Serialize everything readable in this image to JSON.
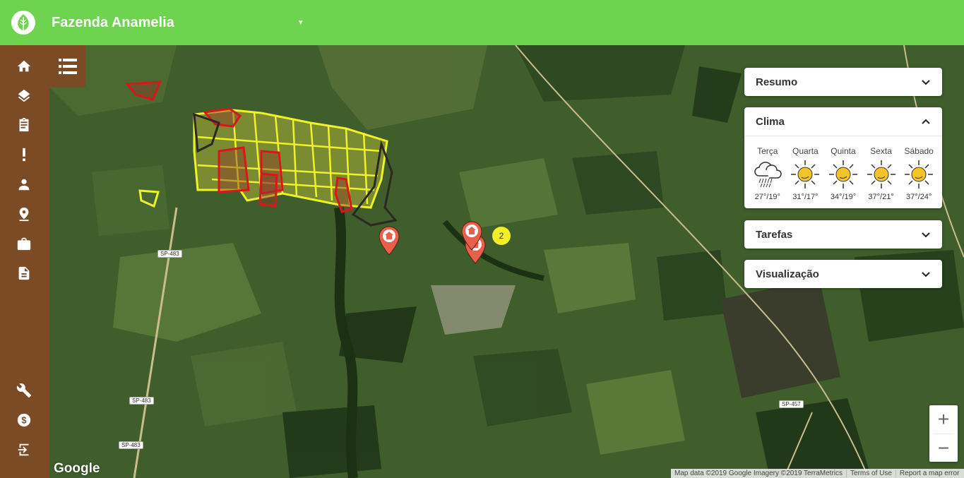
{
  "app": {
    "farm_name": "Fazenda Anamelia",
    "dropdown_caret": "▾",
    "colors": {
      "topbar": "#6ed34e",
      "sidebar": "#7a4b25",
      "field_yellow": "#f1f12a",
      "field_red": "#d81818",
      "marker": "#e8604c",
      "cluster": "#f2ef27"
    }
  },
  "sidebar": {
    "items": [
      {
        "name": "home-icon"
      },
      {
        "name": "layers-icon"
      },
      {
        "name": "clipboard-icon"
      },
      {
        "name": "alert-icon"
      },
      {
        "name": "person-icon"
      },
      {
        "name": "map-pin-icon"
      },
      {
        "name": "briefcase-icon"
      },
      {
        "name": "document-icon"
      },
      {
        "name": "wrench-icon"
      },
      {
        "name": "dollar-icon"
      },
      {
        "name": "logout-icon"
      }
    ]
  },
  "panels": {
    "resumo": {
      "title": "Resumo"
    },
    "clima": {
      "title": "Clima",
      "days": [
        {
          "name": "Terça",
          "temp": "27°/19°",
          "icon": "rain-cloud-icon"
        },
        {
          "name": "Quarta",
          "temp": "31°/17°",
          "icon": "sun-icon"
        },
        {
          "name": "Quinta",
          "temp": "34°/19°",
          "icon": "sun-icon"
        },
        {
          "name": "Sexta",
          "temp": "37°/21°",
          "icon": "sun-icon"
        },
        {
          "name": "Sábado",
          "temp": "37°/24°",
          "icon": "sun-icon"
        }
      ]
    },
    "tarefas": {
      "title": "Tarefas"
    },
    "visualizacao": {
      "title": "Visualização"
    }
  },
  "map": {
    "cluster_count": "2",
    "roads": [
      "SP-483",
      "SP-483",
      "SP-483",
      "SP-457"
    ],
    "zoom_in": "+",
    "zoom_out": "−",
    "google_logo": "Google",
    "attribution": {
      "data": "Map data ©2019 Google Imagery ©2019 TerraMetrics",
      "terms": "Terms of Use",
      "report": "Report a map error"
    }
  }
}
